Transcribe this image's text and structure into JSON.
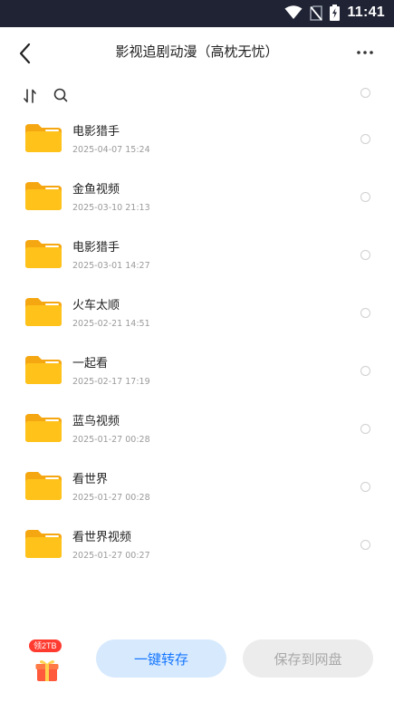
{
  "status_bar": {
    "time": "11:41",
    "icons": [
      "wifi-icon",
      "no-sim-icon",
      "battery-icon"
    ]
  },
  "header": {
    "title": "影视追剧动漫（高枕无忧）",
    "back_icon": "chevron-left-icon",
    "more_icon": "more-horizontal-icon"
  },
  "toolbar": {
    "sort_icon": "sort-icon",
    "search_icon": "search-icon"
  },
  "files": [
    {
      "name": "电影猎手",
      "date": "2025-04-07 15:24"
    },
    {
      "name": "金鱼视频",
      "date": "2025-03-10 21:13"
    },
    {
      "name": "电影猎手",
      "date": "2025-03-01 14:27"
    },
    {
      "name": "火车太顺",
      "date": "2025-02-21 14:51"
    },
    {
      "name": "一起看",
      "date": "2025-02-17 17:19"
    },
    {
      "name": "蓝鸟视频",
      "date": "2025-01-27 00:28"
    },
    {
      "name": "看世界",
      "date": "2025-01-27 00:28"
    },
    {
      "name": "看世界视频",
      "date": "2025-01-27 00:27"
    }
  ],
  "bottom": {
    "gift_badge": "领2TB",
    "transfer_label": "一键转存",
    "save_label": "保存到网盘"
  },
  "colors": {
    "status_bar_bg": "#1f2333",
    "accent": "#1677ff",
    "folder_yellow": "#ffc21a",
    "badge_red": "#ff3b30"
  }
}
